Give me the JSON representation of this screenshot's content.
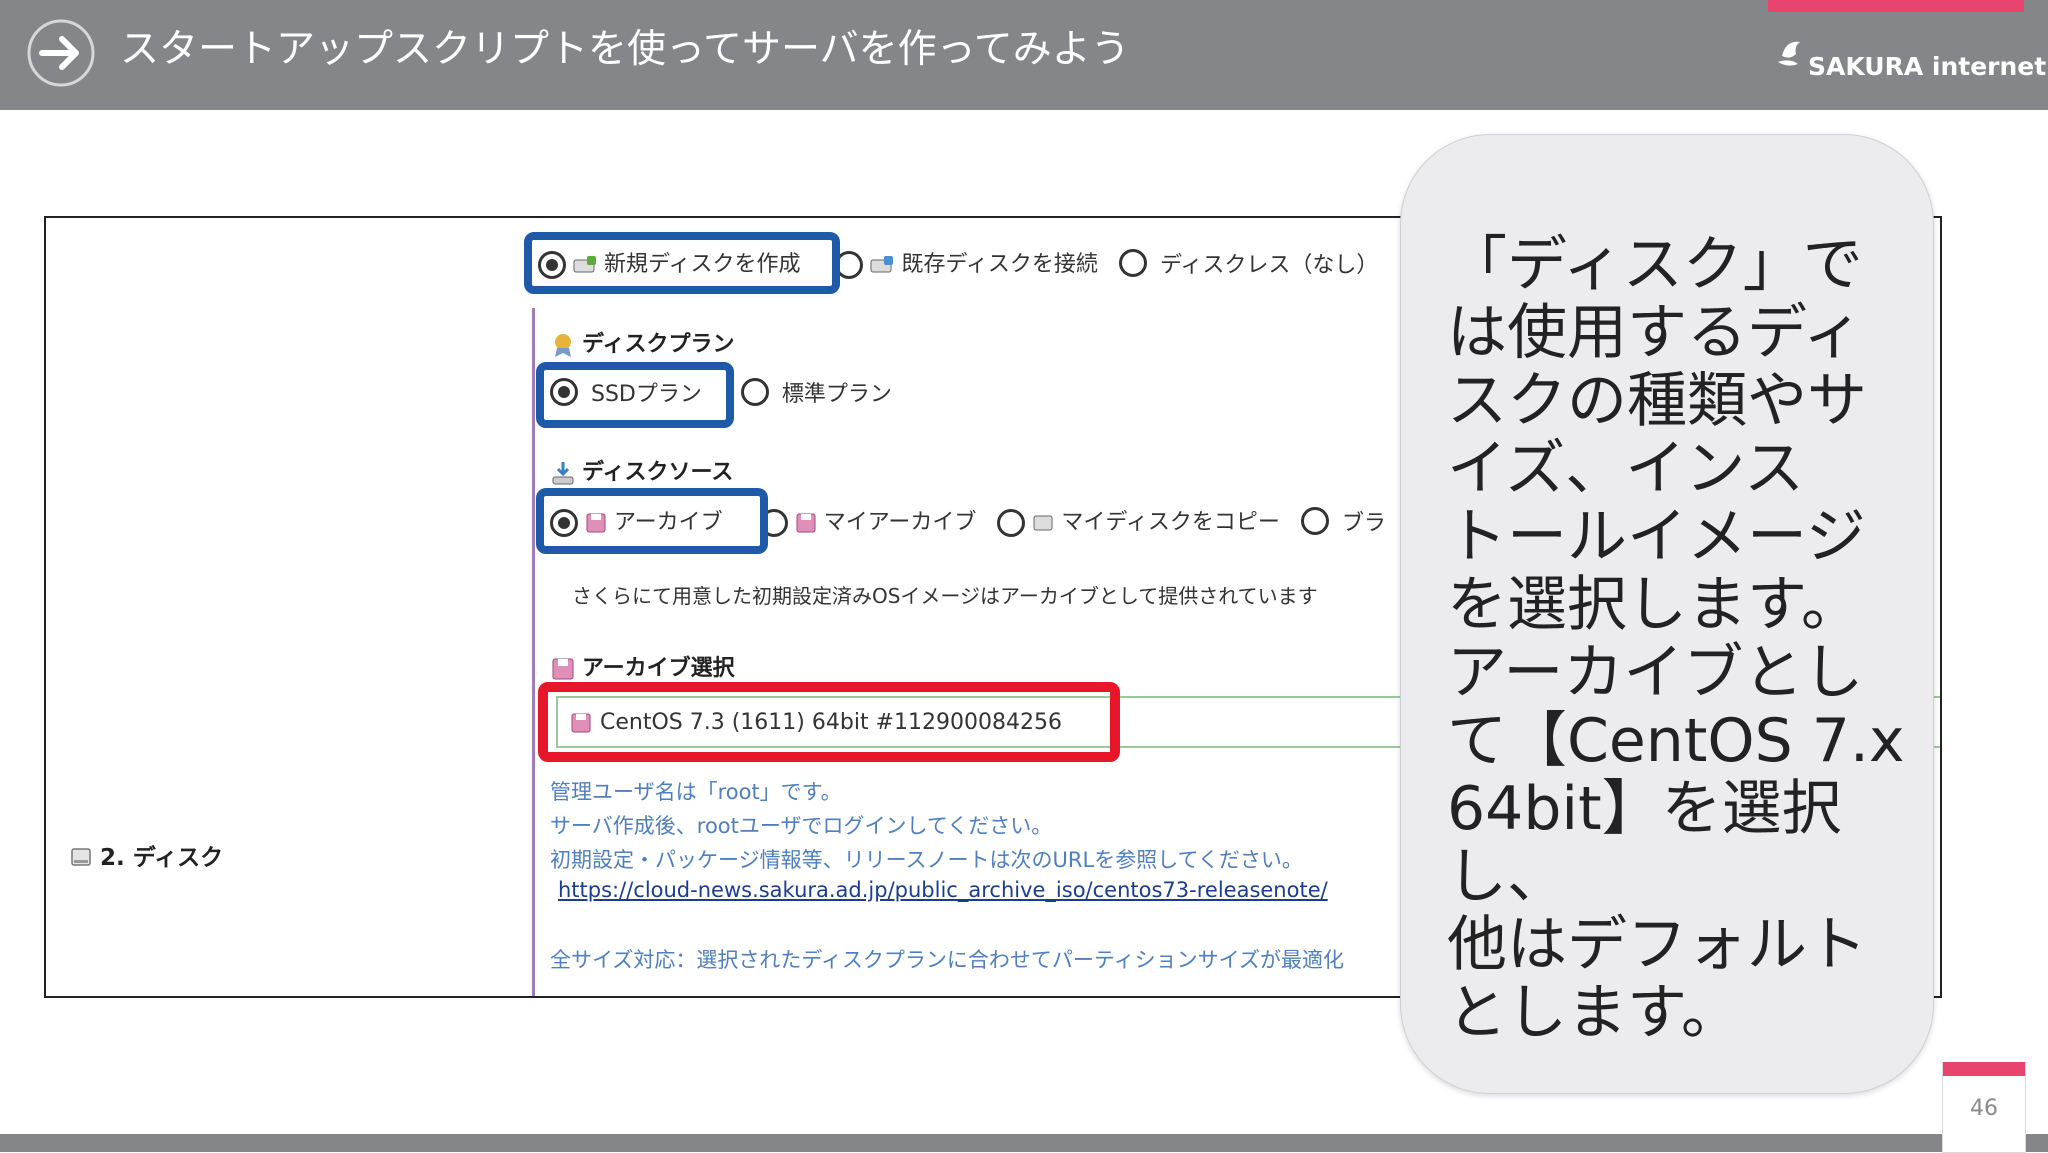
{
  "header": {
    "title": "スタートアップスクリプトを使ってサーバを作ってみよう",
    "logo_text": "SAKURA internet",
    "brand_color": "#e8456e",
    "bar_color": "#858689"
  },
  "screenshot": {
    "section_label": "2. ディスク",
    "disk_options": [
      {
        "label": "新規ディスクを作成",
        "selected": true,
        "icon": "disk-add-icon"
      },
      {
        "label": "既存ディスクを接続",
        "selected": false,
        "icon": "disk-connect-icon"
      },
      {
        "label": "ディスクレス（なし）",
        "selected": false
      }
    ],
    "plan_heading": "ディスクプラン",
    "plan_options": [
      {
        "label": "SSDプラン",
        "selected": true
      },
      {
        "label": "標準プラン",
        "selected": false
      }
    ],
    "source_heading": "ディスクソース",
    "source_options": [
      {
        "label": "アーカイブ",
        "selected": true,
        "icon": "floppy-icon"
      },
      {
        "label": "マイアーカイブ",
        "selected": false,
        "icon": "floppy-icon"
      },
      {
        "label": "マイディスクをコピー",
        "selected": false,
        "icon": "disk-icon"
      },
      {
        "label": "ブラ",
        "selected": false
      }
    ],
    "source_description": "さくらにて用意した初期設定済みOSイメージはアーカイブとして提供されています",
    "archive_heading": "アーカイブ選択",
    "archive_selected": "CentOS 7.3 (1611) 64bit #112900084256",
    "notes": [
      "管理ユーザ名は「root」です。",
      "サーバ作成後、rootユーザでログインしてください。",
      "初期設定・パッケージ情報等、リリースノートは次のURLを参照してください。"
    ],
    "release_note_url": "https://cloud-news.sakura.ad.jp/public_archive_iso/centos73-releasenote/",
    "size_note": "全サイズ対応：選択されたディスクプランに合わせてパーティションサイズが最適化",
    "highlight_blue": "#1e5aa8",
    "highlight_red": "#e8162a"
  },
  "callout": {
    "text": "「ディスク」で\nは使用するディ\nスクの種類やサ\nイズ、インス\nトールイメージ\nを選択します。\nアーカイブとし\nて【CentOS 7.x\n64bit】を選択し、\n他はデフォルト\nとします。"
  },
  "page_number": "46"
}
